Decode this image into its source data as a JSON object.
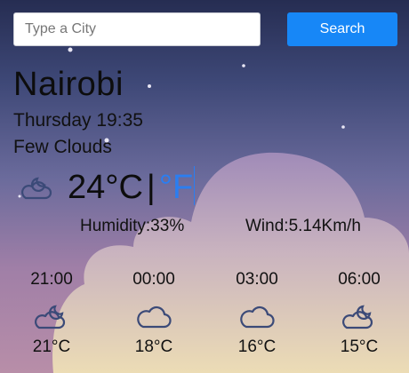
{
  "search": {
    "placeholder": "Type a City",
    "value": "",
    "button_label": "Search"
  },
  "current": {
    "city": "Nairobi",
    "datetime": "Thursday 19:35",
    "description": "Few Clouds",
    "icon": "cloud-moon-icon",
    "temperature": "24",
    "unit_c": "°C",
    "separator": "|",
    "unit_f": "°F",
    "humidity": "Humidity:33%",
    "wind": "Wind:5.14Km/h"
  },
  "forecast": [
    {
      "time": "21:00",
      "icon": "cloud-moon-icon",
      "temp": "21°C"
    },
    {
      "time": "00:00",
      "icon": "cloud-icon",
      "temp": "18°C"
    },
    {
      "time": "03:00",
      "icon": "cloud-icon",
      "temp": "16°C"
    },
    {
      "time": "06:00",
      "icon": "cloud-moon-icon",
      "temp": "15°C"
    }
  ],
  "colors": {
    "accent": "#1787f7",
    "unit_active": "#2b7ef0",
    "sky_top": "#262d52",
    "sky_bottom": "#b88ea8",
    "cloud": "#e7d7bb"
  }
}
